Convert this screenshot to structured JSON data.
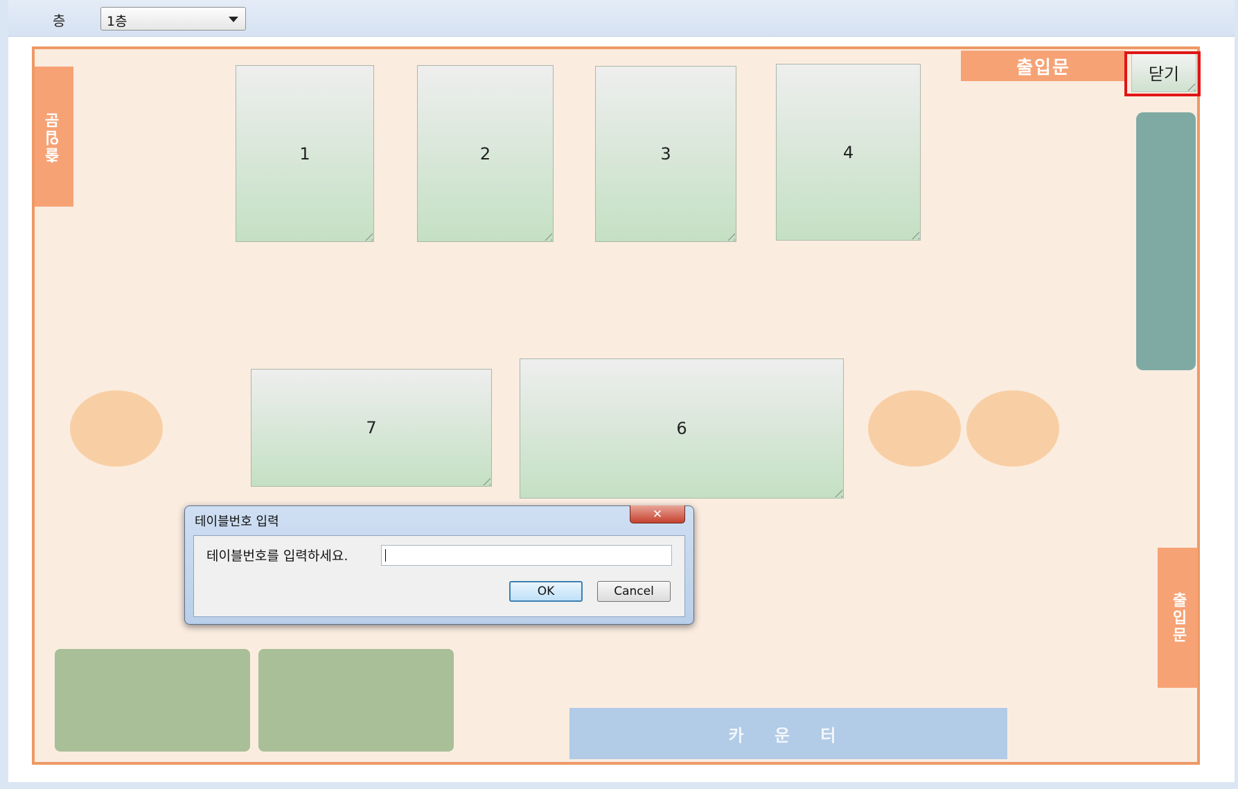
{
  "toolbar": {
    "floor_label": "층",
    "floor_select_value": "1층"
  },
  "floorplan": {
    "doors": {
      "top": "출입문",
      "left": "출입문",
      "right": "출입문"
    },
    "close_button_label": "닫기",
    "tables": [
      {
        "label": "1"
      },
      {
        "label": "2"
      },
      {
        "label": "3"
      },
      {
        "label": "4"
      },
      {
        "label": "7"
      },
      {
        "label": "6"
      }
    ],
    "counter_label": "카 운 터"
  },
  "dialog": {
    "title": "테이블번호 입력",
    "close_glyph": "✕",
    "prompt": "테이블번호를 입력하세요.",
    "input_value": "",
    "ok_label": "OK",
    "cancel_label": "Cancel"
  },
  "colors": {
    "floor_background": "#fbece0",
    "floor_border": "#ee9966",
    "door": "#f6a274",
    "table_gradient_bottom": "#c4e0c4",
    "sofa": "#a8bf98",
    "counter": "#b2cbe6",
    "highlight": "#e01515"
  }
}
